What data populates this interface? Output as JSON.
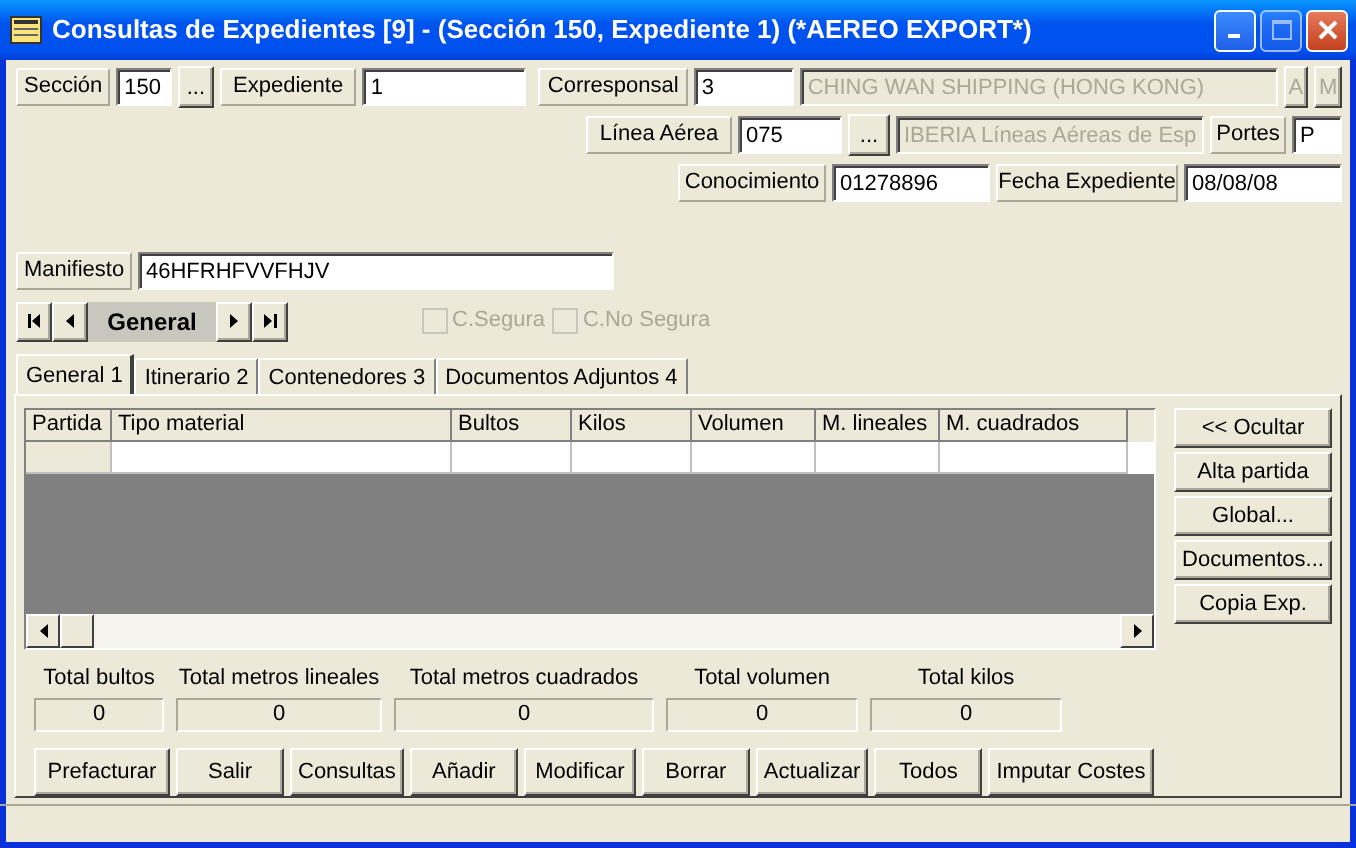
{
  "window": {
    "title": "Consultas de Expedientes [9] - (Sección 150, Expediente 1) (*AEREO EXPORT*)"
  },
  "form_rows": [
    [
      {
        "kind": "label",
        "text": "Sección"
      },
      {
        "kind": "input",
        "value": "150",
        "disabled": false
      },
      {
        "kind": "button",
        "text": "...",
        "disabled": false
      },
      {
        "kind": "label",
        "text": "Expediente"
      },
      {
        "kind": "input",
        "value": "1",
        "disabled": false
      },
      {
        "kind": "gap"
      },
      {
        "kind": "label",
        "text": "Corresponsal"
      },
      {
        "kind": "input",
        "value": "3",
        "disabled": false
      },
      {
        "kind": "input",
        "value": "CHING WAN SHIPPING (HONG KONG)",
        "disabled": true
      },
      {
        "kind": "button",
        "text": "A",
        "disabled": true
      },
      {
        "kind": "button",
        "text": "M",
        "disabled": true
      }
    ],
    [
      {
        "kind": "gap"
      },
      {
        "kind": "label",
        "text": "Línea Aérea"
      },
      {
        "kind": "input",
        "value": "075",
        "disabled": false
      },
      {
        "kind": "button",
        "text": "...",
        "disabled": false
      },
      {
        "kind": "input",
        "value": "IBERIA Líneas Aéreas de Esp",
        "disabled": true
      },
      {
        "kind": "label",
        "text": "Portes"
      },
      {
        "kind": "input",
        "value": "P",
        "disabled": false
      }
    ],
    [
      {
        "kind": "gap"
      },
      {
        "kind": "label",
        "text": "Conocimiento"
      },
      {
        "kind": "input",
        "value": "01278896",
        "disabled": false
      },
      {
        "kind": "label",
        "text": "Fecha Expediente"
      },
      {
        "kind": "input",
        "value": "08/08/08",
        "disabled": false
      }
    ],
    [
      {
        "kind": "label",
        "text": "Manifiesto"
      },
      {
        "kind": "input",
        "value": "46HFRHFVVFHJV",
        "disabled": false
      }
    ]
  ],
  "navigator": {
    "label": "General"
  },
  "checkboxes": [
    {
      "label": "C.Segura",
      "checked": false,
      "disabled": true
    },
    {
      "label": "C.No Segura",
      "checked": false,
      "disabled": true
    }
  ],
  "tabs": [
    {
      "label": "General 1",
      "selected": true
    },
    {
      "label": "Itinerario 2",
      "selected": false
    },
    {
      "label": "Contenedores 3",
      "selected": false
    },
    {
      "label": "Documentos Adjuntos 4",
      "selected": false
    }
  ],
  "grid": {
    "columns": [
      "Partida",
      "Tipo material",
      "Bultos",
      "Kilos",
      "Volumen",
      "M. lineales",
      "M. cuadrados"
    ]
  },
  "side_buttons": [
    "<< Ocultar",
    "Alta partida",
    "Global...",
    "Documentos...",
    "Copia Exp."
  ],
  "totals": [
    {
      "label": "Total bultos",
      "value": "0"
    },
    {
      "label": "Total metros lineales",
      "value": "0"
    },
    {
      "label": "Total metros cuadrados",
      "value": "0"
    },
    {
      "label": "Total volumen",
      "value": "0"
    },
    {
      "label": "Total kilos",
      "value": "0"
    }
  ],
  "buttons": [
    "Prefacturar",
    "Salir",
    "Consultas",
    "Añadir",
    "Modificar",
    "Borrar",
    "Actualizar",
    "Todos",
    "Imputar Costes"
  ]
}
